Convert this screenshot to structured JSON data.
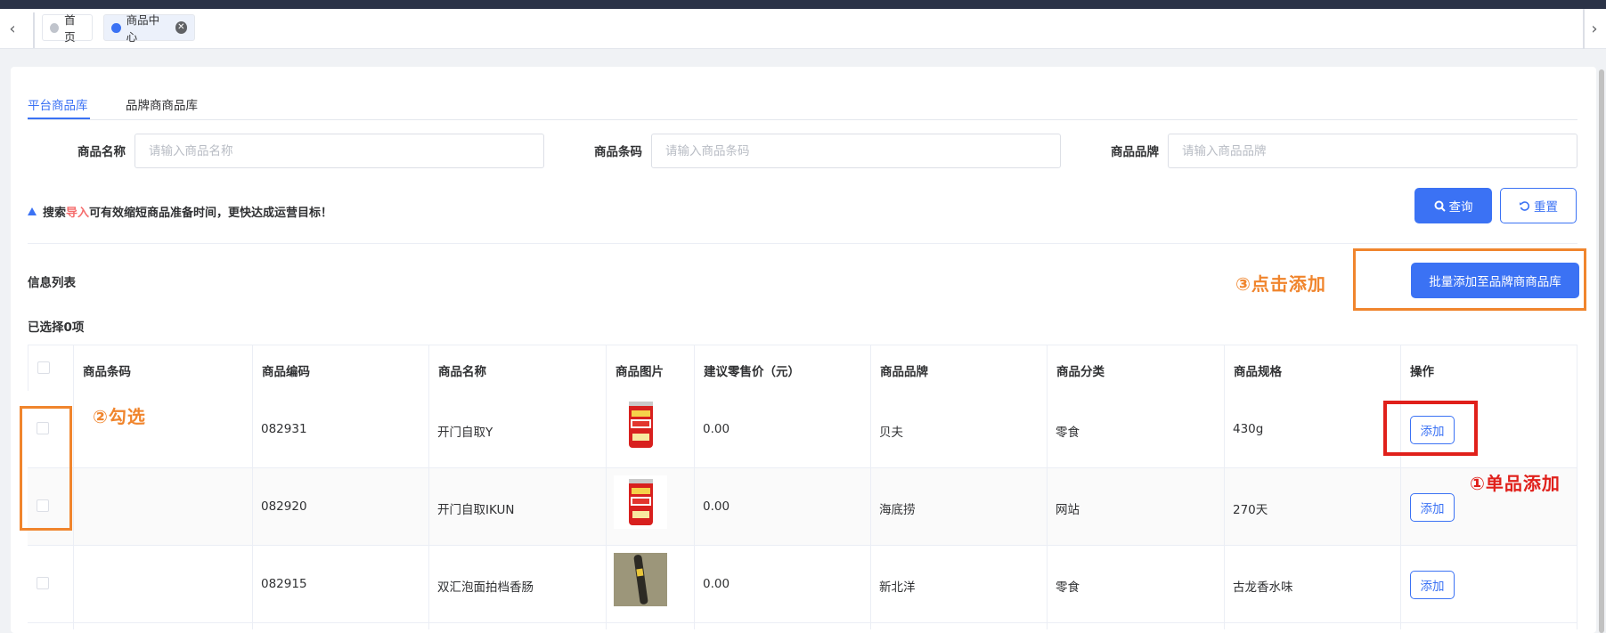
{
  "tabbar": {
    "nav_left": "‹",
    "nav_right": "›",
    "tabs": [
      {
        "label": "首页"
      },
      {
        "label": "商品中心"
      }
    ]
  },
  "library_tabs": [
    "平台商品库",
    "品牌商商品库"
  ],
  "filters": [
    {
      "label": "商品名称",
      "placeholder": "请输入商品名称",
      "value": ""
    },
    {
      "label": "商品条码",
      "placeholder": "请输入商品条码",
      "value": ""
    },
    {
      "label": "商品品牌",
      "placeholder": "请输入商品品牌",
      "value": ""
    }
  ],
  "tip": {
    "pre": "搜索",
    "highlight": "导入",
    "post": "可有效缩短商品准备时间，更快达成运营目标！"
  },
  "buttons": {
    "query": "查询",
    "reset": "重置",
    "batch_add": "批量添加至品牌商商品库",
    "add": "添加"
  },
  "list": {
    "title": "信息列表",
    "selected": "已选择0项"
  },
  "table": {
    "headers": [
      "商品条码",
      "商品编码",
      "商品名称",
      "商品图片",
      "建议零售价（元）",
      "商品品牌",
      "商品分类",
      "商品规格",
      "操作"
    ],
    "rows": [
      {
        "barcode": "",
        "code": "082931",
        "name": "开门自取Y",
        "image": "can-drink",
        "price": "0.00",
        "brand": "贝夫",
        "category": "零食",
        "spec": "430g"
      },
      {
        "barcode": "",
        "code": "082920",
        "name": "开门自取IKUN",
        "image": "can-drink",
        "price": "0.00",
        "brand": "海底捞",
        "category": "网站",
        "spec": "270天"
      },
      {
        "barcode": "",
        "code": "082915",
        "name": "双汇泡面拍档香肠",
        "image": "sausage",
        "price": "0.00",
        "brand": "新北洋",
        "category": "零食",
        "spec": "古龙香水味"
      }
    ]
  },
  "annotations": {
    "step1": "①单品添加",
    "step2": "②勾选",
    "step3": "③点击添加"
  },
  "colors": {
    "primary": "#3b72f4",
    "annotation_orange": "#f0852d",
    "annotation_red": "#e0201b",
    "header_bar": "#2b3347"
  },
  "icons": [
    "chevron-left-icon",
    "chevron-right-icon",
    "close-icon",
    "search-icon",
    "refresh-icon",
    "warning-icon"
  ]
}
